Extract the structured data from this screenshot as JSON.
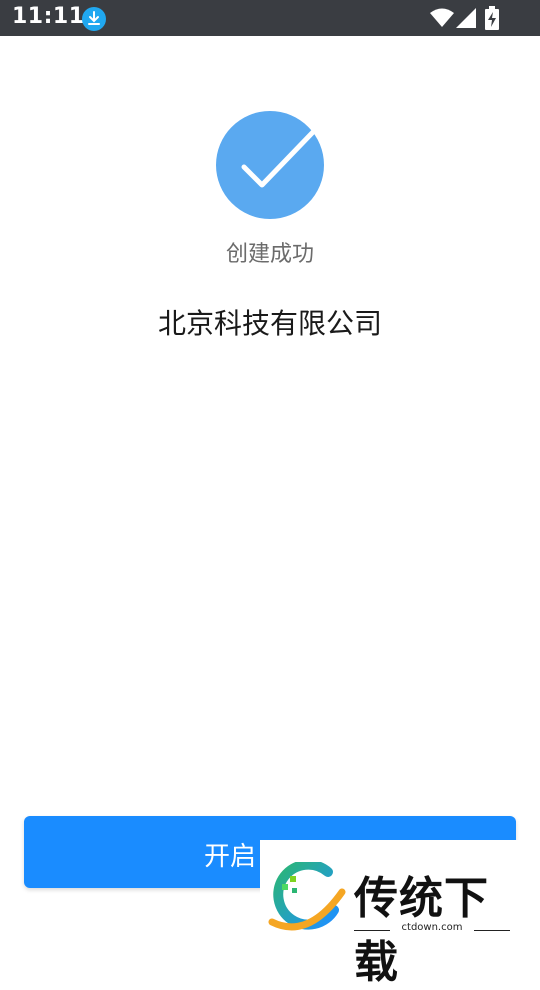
{
  "status_bar": {
    "time": "11:11",
    "icons": [
      "download-notification-icon",
      "wifi-icon",
      "signal-icon",
      "battery-charging-icon"
    ],
    "background": "#3a3d42"
  },
  "success": {
    "icon": "check-circle-icon",
    "icon_color": "#5aa9f0",
    "label": "创建成功"
  },
  "company": {
    "name": "北京科技有限公司"
  },
  "action": {
    "button_label": "开启",
    "button_color": "#1a8cff"
  },
  "watermark": {
    "title": "传统下载",
    "subtitle": "ctdown.com"
  }
}
